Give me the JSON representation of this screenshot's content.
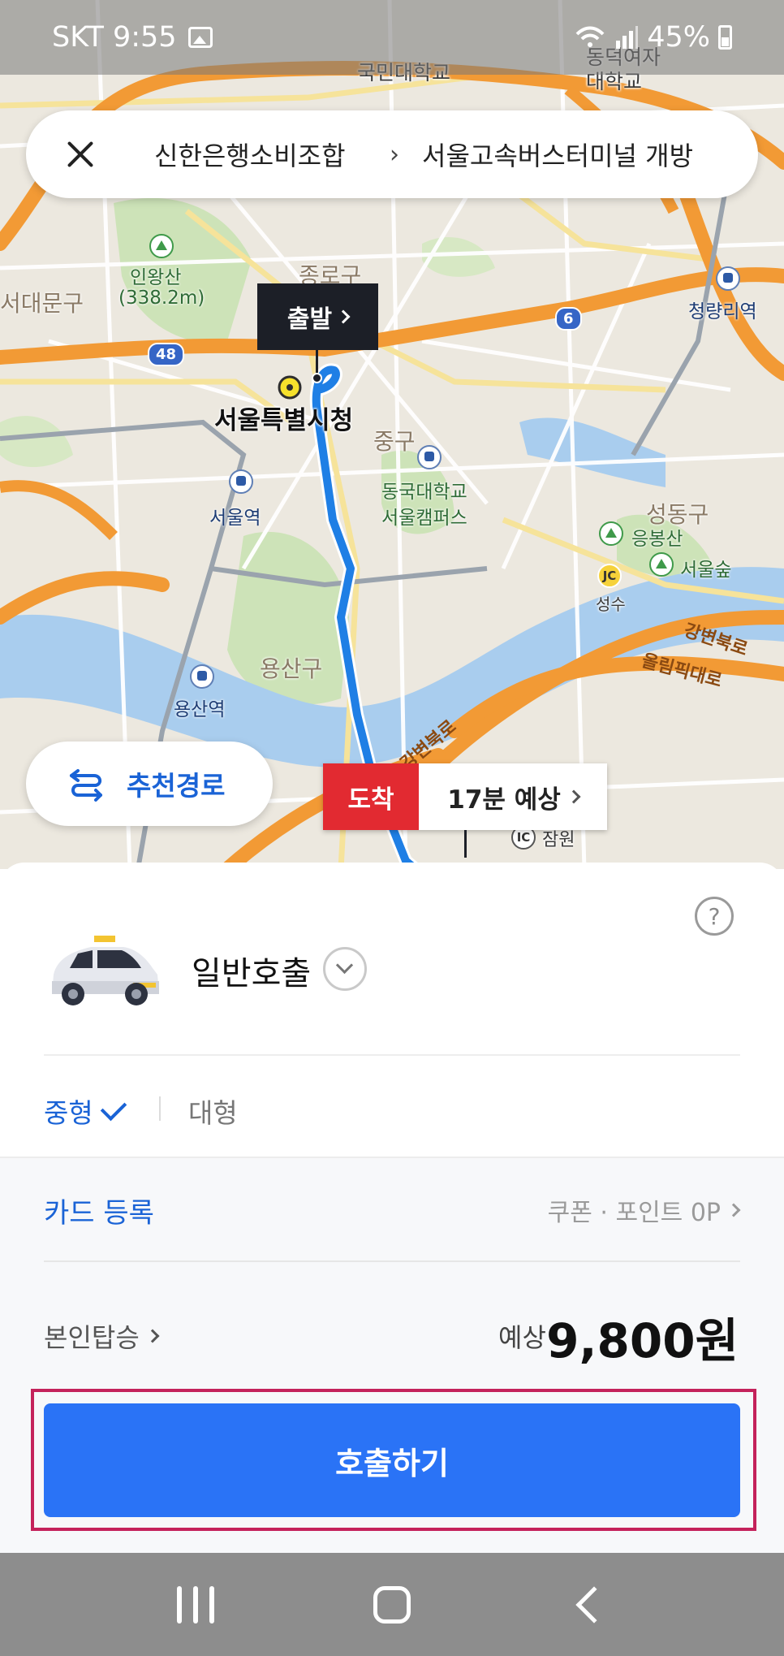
{
  "status_bar": {
    "carrier_time": "SKT 9:55",
    "battery": "45%"
  },
  "search_bar": {
    "origin": "신한은행소비조합",
    "separator": "›",
    "destination": "서울고속버스터미널 개방"
  },
  "map": {
    "labels": {
      "gukmin": "국민대학교",
      "dongduk": "동덕여자대학교",
      "inwangsan": "인왕산",
      "inwangsan_elev": "(338.2m)",
      "seodaemun": "서대문구",
      "jongno": "종로구",
      "cheongnyangni": "청량리역",
      "seoul_cityhall": "서울특별시청",
      "junggu": "중구",
      "dongguk": "동국대학교",
      "dongguk_campus": "서울캠퍼스",
      "seoul_station": "서울역",
      "seongdong": "성동구",
      "eungbongsan": "응봉산",
      "seoul_forest": "서울숲",
      "seongsu": "성수",
      "gangbyeonbuk": "강변북로",
      "olympic": "올림픽대로",
      "yongsan": "용산구",
      "yongsan_station": "용산역",
      "gangbyeonbuk_2": "강변북로",
      "jamwon": "잠원",
      "route_6": "6",
      "route_48": "48",
      "jc": "JC",
      "ic": "IC"
    },
    "route_color": "#1f7fe5",
    "start_label": "출발",
    "arrival_label": "도착",
    "eta": "17분 예상",
    "recommend_route": "추천경로"
  },
  "sheet": {
    "help": "?",
    "call_type": "일반호출",
    "size_options": [
      "중형",
      "대형"
    ],
    "selected_size": "중형",
    "card_register": "카드 등록",
    "coupon_points": "쿠폰 · 포인트 0P",
    "self_ride": "본인탑승",
    "estimate_label": "예상",
    "estimate_price": "9,800원",
    "call_button": "호출하기"
  },
  "colors": {
    "accent": "#2a73f6",
    "link": "#1a63d6",
    "arrival": "#e22a31",
    "highlight_border": "#c4225b"
  }
}
